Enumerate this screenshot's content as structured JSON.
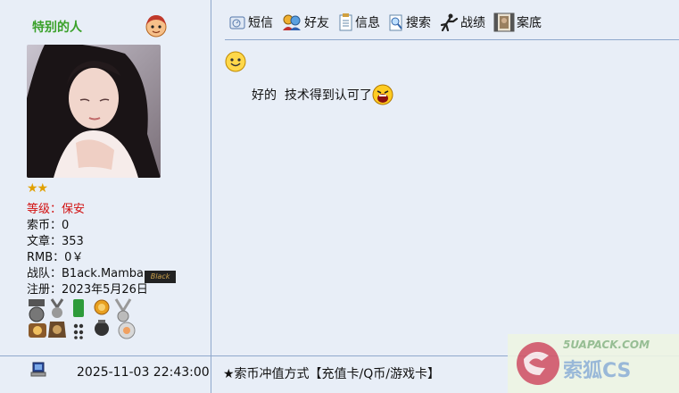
{
  "author": {
    "name": "特别的人",
    "stars": "★★",
    "rank": "等级：保安",
    "coins": "索币：0",
    "posts": "文章：353",
    "rmb": "RMB：0￥",
    "team": "战队：B1ack.Mamba",
    "team_badge": "Black",
    "registered": "注册：2023年5月26日"
  },
  "toolbar": {
    "items": [
      {
        "label": "短信",
        "icon": "message-icon"
      },
      {
        "label": "好友",
        "icon": "friends-icon"
      },
      {
        "label": "信息",
        "icon": "info-icon"
      },
      {
        "label": "搜索",
        "icon": "search-icon"
      },
      {
        "label": "战绩",
        "icon": "record-icon"
      },
      {
        "label": "案底",
        "icon": "case-icon"
      }
    ]
  },
  "post": {
    "body": "好的  技术得到认可了"
  },
  "footer": {
    "time": "2025-11-03 22:43:00",
    "signature": "★索币冲值方式【充值卡/Q币/游戏卡】"
  },
  "watermark": {
    "url_text": "5UAPACK.COM",
    "brand": "索狐CS"
  },
  "colors": {
    "background": "#e8eef7",
    "border": "#8fa8cc",
    "username": "#3aa12a",
    "rank": "#d21010"
  }
}
